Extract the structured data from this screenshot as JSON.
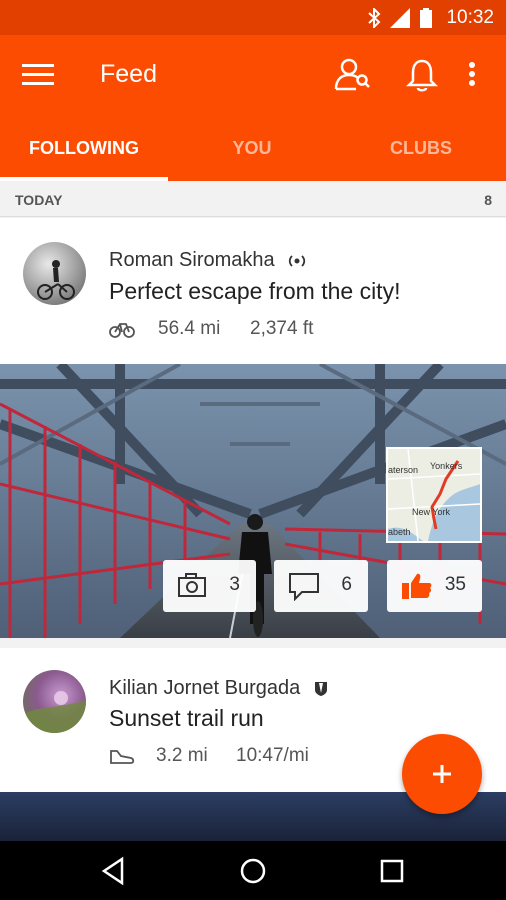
{
  "status_bar": {
    "time": "10:32",
    "icons": [
      "bluetooth-icon",
      "signal-icon",
      "battery-icon"
    ]
  },
  "app_bar": {
    "title": "Feed",
    "icons": [
      "menu-icon",
      "find-friends-icon",
      "notifications-icon",
      "overflow-menu-icon"
    ]
  },
  "tabs": [
    {
      "label": "FOLLOWING",
      "active": true
    },
    {
      "label": "YOU",
      "active": false
    },
    {
      "label": "CLUBS",
      "active": false
    }
  ],
  "section": {
    "label": "TODAY",
    "count": "8"
  },
  "feed": [
    {
      "athlete": "Roman Siromakha",
      "badge": "device-icon",
      "title": "Perfect escape from the city!",
      "sport": "bike-icon",
      "stats": [
        "56.4 mi",
        "2,374 ft"
      ],
      "photos": "3",
      "comments": "6",
      "kudos": "35",
      "map_labels": [
        "aterson",
        "Yonkers",
        "New York",
        "abeth"
      ]
    },
    {
      "athlete": "Kilian Jornet Burgada",
      "badge": "summit-icon",
      "title": "Sunset trail run",
      "sport": "run-shoe-icon",
      "stats": [
        "3.2 mi",
        "10:47/mi"
      ]
    }
  ],
  "colors": {
    "brand": "#fc4c02",
    "status_bar": "#e14000"
  },
  "fab": {
    "icon": "plus-icon"
  },
  "nav_bar": {
    "icons": [
      "back-icon",
      "home-icon",
      "recents-icon"
    ]
  }
}
